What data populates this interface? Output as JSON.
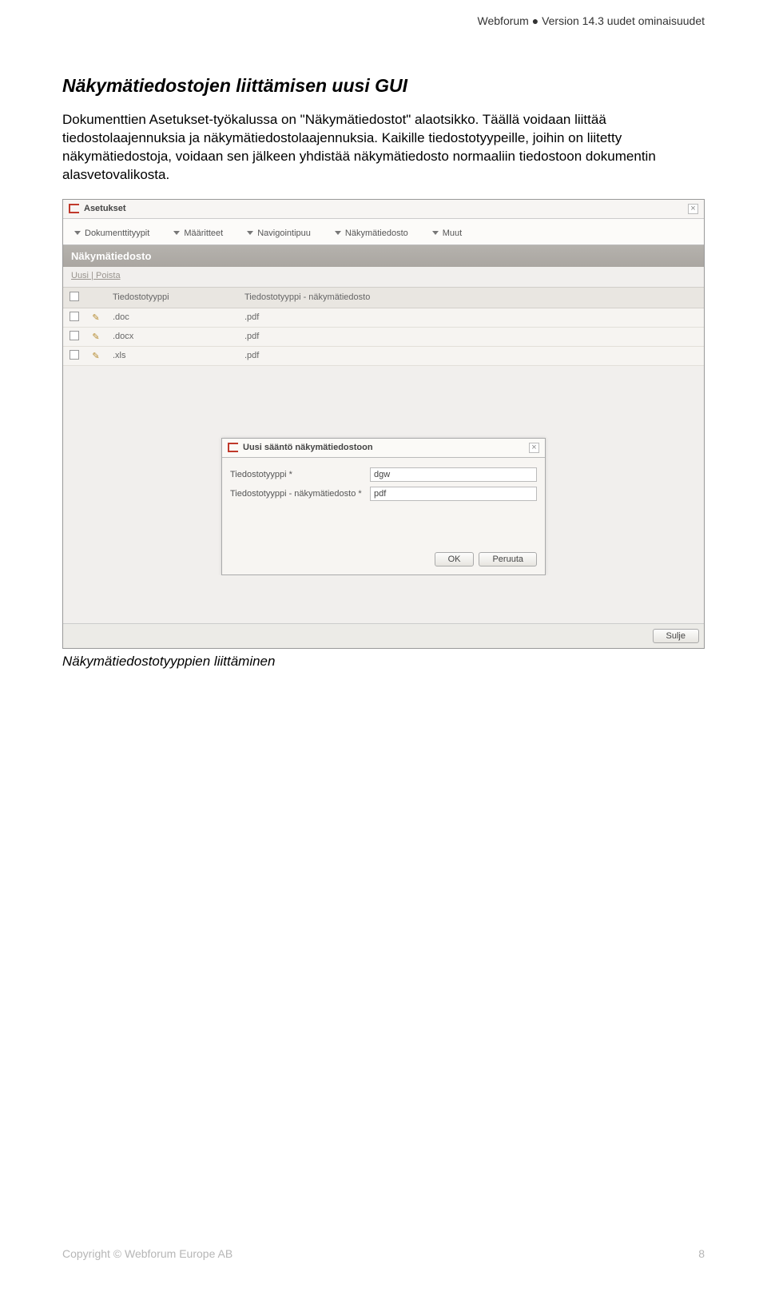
{
  "page_header": "Webforum ● Version 14.3 uudet ominaisuudet",
  "section_title": "Näkymätiedostojen liittämisen uusi GUI",
  "body_text": "Dokumenttien Asetukset-työkalussa on \"Näkymätiedostot\" alaotsikko. Täällä voidaan liittää tiedostolaajennuksia ja näkymätiedostolaajennuksia. Kaikille tiedostotyypeille, joihin on liitetty näkymätiedostoja, voidaan sen jälkeen yhdistää näkymätiedosto normaaliin tiedostoon dokumentin alasvetovalikosta.",
  "app": {
    "title": "Asetukset",
    "tabs": [
      "Dokumenttityypit",
      "Määritteet",
      "Navigointipuu",
      "Näkymätiedosto",
      "Muut"
    ],
    "section": "Näkymätiedosto",
    "actions": {
      "new": "Uusi",
      "sep": " | ",
      "delete": "Poista"
    },
    "columns": {
      "col1": "Tiedostotyyppi",
      "col2": "Tiedostotyyppi - näkymätiedosto"
    },
    "rows": [
      {
        "c1": ".doc",
        "c2": ".pdf"
      },
      {
        "c1": ".docx",
        "c2": ".pdf"
      },
      {
        "c1": ".xls",
        "c2": ".pdf"
      }
    ],
    "modal": {
      "title": "Uusi sääntö näkymätiedostoon",
      "field1_label": "Tiedostotyyppi *",
      "field1_value": "dgw",
      "field2_label": "Tiedostotyyppi - näkymätiedosto *",
      "field2_value": "pdf",
      "ok": "OK",
      "cancel": "Peruuta"
    },
    "close_label": "Sulje"
  },
  "caption": "Näkymätiedostotyyppien liittäminen",
  "footer": {
    "copyright": "Copyright © Webforum Europe AB",
    "page": "8"
  }
}
